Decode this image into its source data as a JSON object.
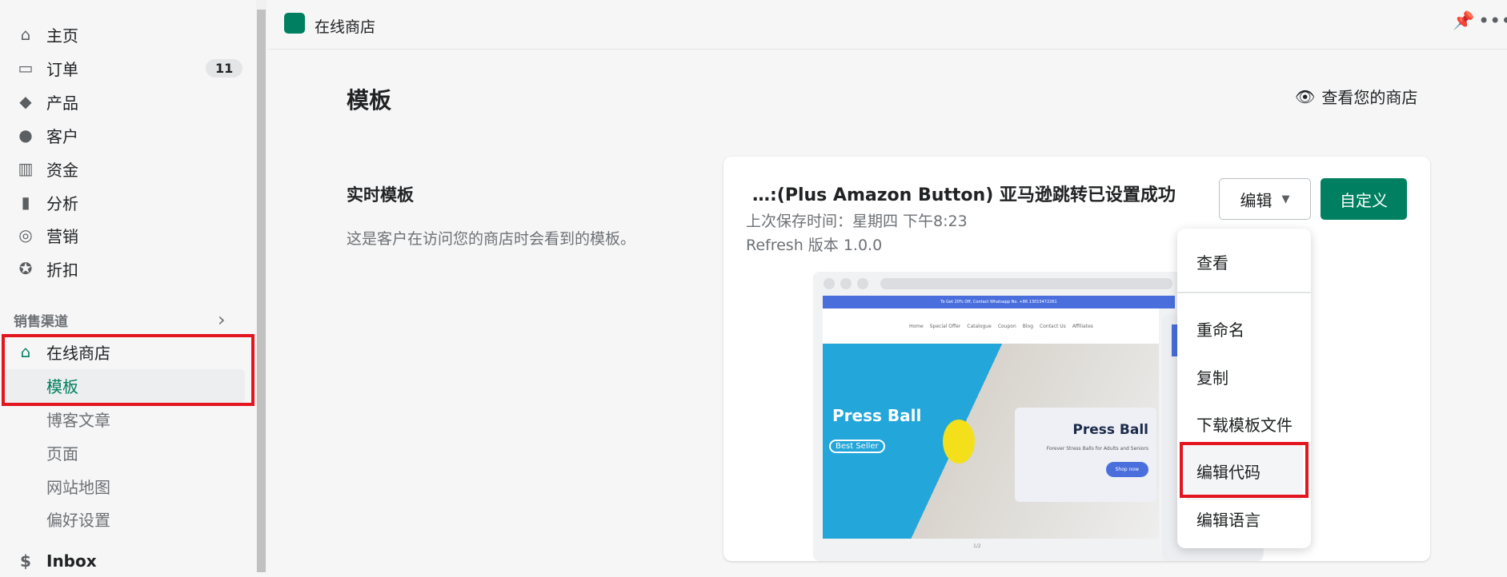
{
  "sidebar": {
    "items": [
      {
        "label": "主页",
        "icon": "home-icon"
      },
      {
        "label": "订单",
        "icon": "inbox-icon",
        "badge": "11"
      },
      {
        "label": "产品",
        "icon": "tag-icon"
      },
      {
        "label": "客户",
        "icon": "person-icon"
      },
      {
        "label": "资金",
        "icon": "bank-icon"
      },
      {
        "label": "分析",
        "icon": "bar-chart-icon"
      },
      {
        "label": "营销",
        "icon": "target-icon"
      },
      {
        "label": "折扣",
        "icon": "discount-icon"
      }
    ],
    "section_title": "销售渠道",
    "online_store": "在线商店",
    "sub_items": [
      "模板",
      "博客文章",
      "页面",
      "网站地图",
      "偏好设置"
    ],
    "inbox": "Inbox"
  },
  "topbar": {
    "title": "在线商店"
  },
  "page": {
    "title": "模板",
    "view_store": "查看您的商店"
  },
  "live_theme": {
    "heading": "实时模板",
    "description": "这是客户在访问您的商店时会看到的模板。"
  },
  "theme_card": {
    "name": "…:(Plus Amazon Button) 亚马逊跳转已设置成功",
    "saved": "上次保存时间：星期四 下午8:23",
    "version": "Refresh 版本 1.0.0",
    "edit_button": "编辑",
    "customize_button": "自定义"
  },
  "preview": {
    "announcement": "To Get 20% Off, Contact Whatsapp No. +86 13015472261",
    "nav": [
      "Home",
      "Special Offer",
      "Catalogue",
      "Coupon",
      "Blog",
      "Contact Us",
      "Affiliates"
    ],
    "hero_left": "Press Ball",
    "badge": "Best Seller",
    "hero_title": "Press Ball",
    "hero_sub": "Forever Stress Balls for Adults and Seniors",
    "shop_now": "Shop now",
    "pager": "1/2"
  },
  "menu": {
    "items": [
      "查看",
      "重命名",
      "复制",
      "下载模板文件",
      "编辑代码",
      "编辑语言"
    ]
  },
  "colors": {
    "accent": "#008060",
    "highlight": "#e3151f",
    "preview_blue": "#4a6fdc",
    "hero_cyan": "#23a6d9"
  }
}
